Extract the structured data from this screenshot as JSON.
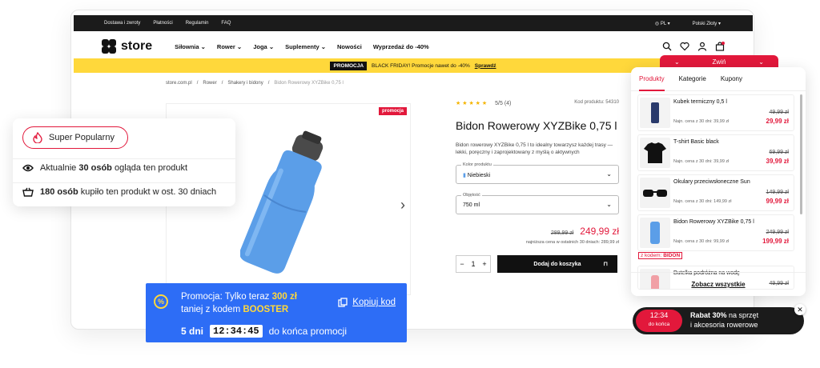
{
  "topbar": {
    "links": [
      "Dostawa i zwroty",
      "Płatności",
      "Regulamin",
      "FAQ"
    ],
    "lang": "PL",
    "currency": "Polski Złoty"
  },
  "nav": {
    "logo": "store",
    "menu": [
      "Siłownia",
      "Rower",
      "Joga",
      "Suplementy",
      "Nowości",
      "Wyprzedaż do -40%"
    ],
    "cart_count": "0"
  },
  "promo_strip": {
    "tag": "PROMOCJA",
    "text": "BLACK FRIDAY! Promocje nawet do -40%",
    "link": "Sprawdź"
  },
  "breadcrumb": [
    "store.com.pl",
    "/",
    "Rower",
    "/",
    "Shakery i bidony",
    "/",
    "Bidon Rowerowy XYZBike 0,75 l"
  ],
  "gallery": {
    "badge": "promocja"
  },
  "product": {
    "rating_text": "5/5 (4)",
    "sku": "Kod produktu: 54310",
    "title": "Bidon Rowerowy XYZBike 0,75 l",
    "description": "Bidon rowerowy XYZBike 0,75 l to idealny towarzysz każdej trasy — lekki, poręczny i zaprojektowany z myślą o aktywnych",
    "color_label": "Kolor produktu",
    "color_value": "Niebieski",
    "volume_label": "Objętość",
    "volume_value": "750 ml",
    "old_price": "289,99 zł",
    "price": "249,99 zł",
    "lowest": "najniższa cena w ostatnich 30 dniach: 289,99 zł",
    "qty": "1",
    "add_to_cart": "Dodaj do koszyka"
  },
  "social_card": {
    "badge": "Super Popularny",
    "viewing_pre": "Aktualnie",
    "viewing_num": "30 osób",
    "viewing_post": "ogląda ten produkt",
    "bought_num": "180 osób",
    "bought_post": "kupiło ten produkt w ost. 30 dniach"
  },
  "promo_box": {
    "icon": "%",
    "line1_pre": "Promocja: Tylko teraz",
    "line1_amount": "300 zł",
    "line2_pre": "taniej z kodem",
    "code": "BOOSTER",
    "copy": "Kopiuj kod",
    "days": "5 dni",
    "clock": "12:34:45",
    "end": "do końca promocji"
  },
  "side_panel": {
    "collapse": "Zwiń",
    "tabs": [
      "Produkty",
      "Kategorie",
      "Kupony"
    ],
    "items": [
      {
        "name": "Kubek termiczny 0,5 l",
        "old": "49,99 zł",
        "new": "29,99 zł",
        "lowest": "Najn. cena z 30 dni: 39,99 zł"
      },
      {
        "name": "T-shirt Basic black",
        "old": "69,99 zł",
        "new": "39,99 zł",
        "lowest": "Najn. cena z 30 dni: 39,99 zł"
      },
      {
        "name": "Okulary przeciwsłoneczne Sun",
        "old": "149,99 zł",
        "new": "99,99 zł",
        "lowest": "Najn. cena z 30 dni: 149,99 zł"
      },
      {
        "name": "Bidon Rowerowy XYZBike 0,75 l",
        "old": "249,99 zł",
        "new": "199,99 zł",
        "lowest": "Najn. cena z 30 dni: 99,99 zł",
        "code_pre": "z kodem:",
        "code": "BIDON"
      },
      {
        "name": "Butelka podróżna na wodę",
        "old": "49,99 zł",
        "new": "",
        "lowest": ""
      }
    ],
    "see_all": "Zobacz wszystkie"
  },
  "rabat": {
    "clock": "12:34",
    "clock_sub": "do końca",
    "bold": "Rabat 30%",
    "rest1": "na sprzęt",
    "rest2": "i akcesoria rowerowe"
  },
  "colors": {
    "accent": "#e2183b",
    "promo_yellow": "#ffd83b",
    "promo_blue": "#2d6df6"
  }
}
